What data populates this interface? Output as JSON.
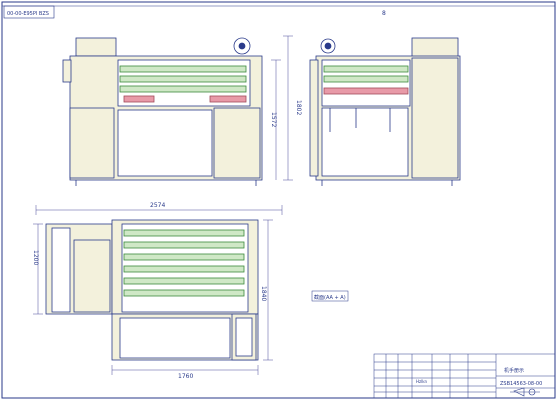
{
  "drawing": {
    "stamp_top_left": "00-00-E95PI BZS",
    "top_right_mark": "8",
    "dim_front_width": "2574",
    "dim_side_height_outer": "1802",
    "dim_side_height_inner": "1572",
    "dim_plan_depth": "1200",
    "dim_plan_total_depth": "1840",
    "dim_plan_width": "1760",
    "view_note": "截面(AA + A)",
    "title_block": {
      "name": "机手册示",
      "drawing_number": "ZSB14563-08-00",
      "cell_note": "Hzlkn"
    }
  },
  "colors": {
    "line": "#2a3a8a",
    "fill_body": "#f3f1dc",
    "roller_green": "#cfe8c6",
    "roller_line": "#3c8a3c",
    "accent_pink": "#e89aa8",
    "dim_line": "#4a4a9a"
  }
}
